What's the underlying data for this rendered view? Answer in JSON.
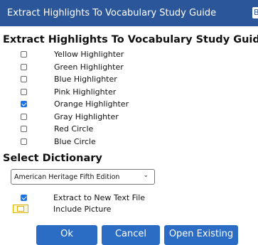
{
  "window": {
    "title": "Extract Highlights To Vocabulary Study Guide",
    "close_glyph": "B"
  },
  "main": {
    "heading": "Extract Highlights To Vocabulary Study Guide",
    "highlights": [
      {
        "label": "Yellow Highlighter",
        "checked": false
      },
      {
        "label": "Green Highlighter",
        "checked": false
      },
      {
        "label": "Blue Highlighter",
        "checked": false
      },
      {
        "label": "Pink Highlighter",
        "checked": false
      },
      {
        "label": "Orange Highlighter",
        "checked": true
      },
      {
        "label": "Gray Highlighter",
        "checked": false
      },
      {
        "label": "Red Circle",
        "checked": false
      },
      {
        "label": "Blue Circle",
        "checked": false
      }
    ]
  },
  "dictionary": {
    "heading": "Select Dictionary",
    "selected": "American Heritage Fifth Edition"
  },
  "options": {
    "extract_new_file": {
      "label": "Extract to New Text File",
      "checked": true
    },
    "include_picture": {
      "label": "Include Picture",
      "checked": false
    }
  },
  "buttons": {
    "ok": "Ok",
    "cancel": "Cancel",
    "open_existing": "Open Existing"
  },
  "colors": {
    "titlebar": "#2b579a",
    "button": "#2b6cc4",
    "checkbox_checked": "#1a73e8",
    "toggle_accent": "#e0b000"
  }
}
